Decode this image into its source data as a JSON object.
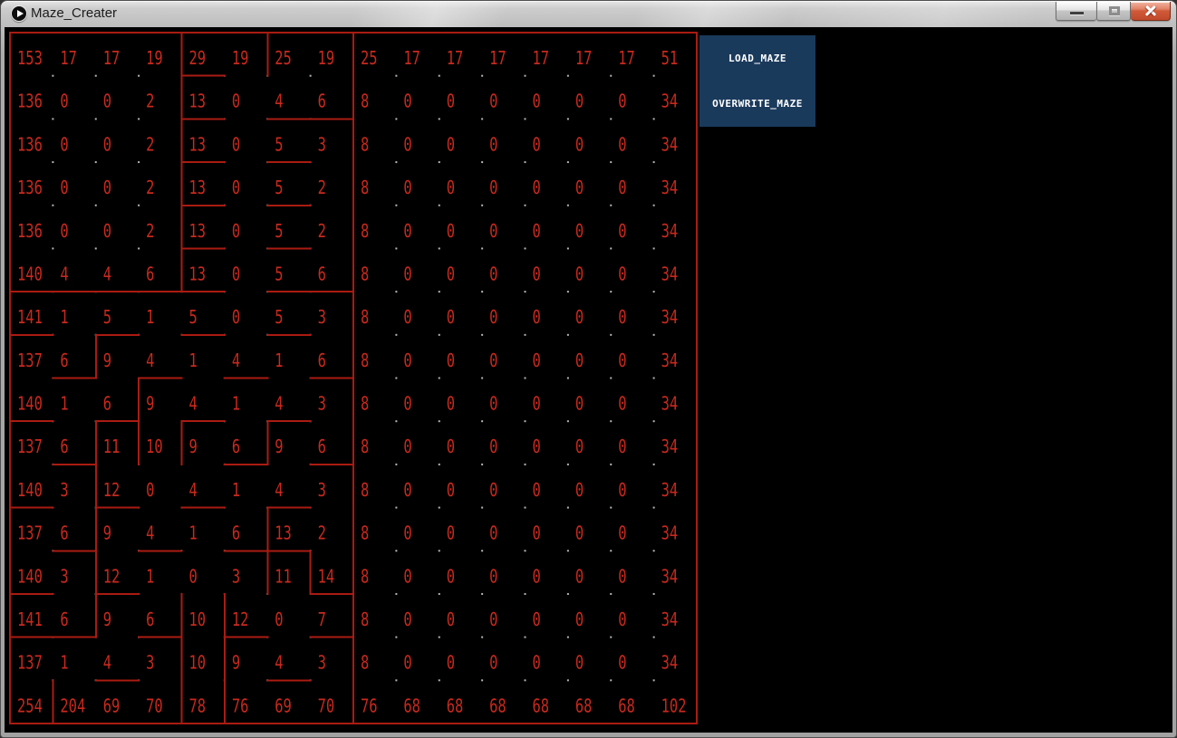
{
  "window": {
    "title": "Maze_Creater",
    "icon": "play-circle-icon",
    "controls": [
      {
        "name": "minimize",
        "icon": "minimize-icon"
      },
      {
        "name": "maximize",
        "icon": "maximize-icon"
      },
      {
        "name": "close",
        "icon": "close-icon"
      }
    ]
  },
  "buttons": [
    {
      "label": "LOAD_MAZE"
    },
    {
      "label": "OVERWRITE_MAZE"
    }
  ],
  "maze": {
    "rows": 16,
    "cols": 16,
    "grid": [
      [
        153,
        17,
        17,
        19,
        29,
        19,
        25,
        19,
        25,
        17,
        17,
        17,
        17,
        17,
        17,
        51
      ],
      [
        136,
        0,
        0,
        2,
        13,
        0,
        4,
        6,
        8,
        0,
        0,
        0,
        0,
        0,
        0,
        34
      ],
      [
        136,
        0,
        0,
        2,
        13,
        0,
        5,
        3,
        8,
        0,
        0,
        0,
        0,
        0,
        0,
        34
      ],
      [
        136,
        0,
        0,
        2,
        13,
        0,
        5,
        2,
        8,
        0,
        0,
        0,
        0,
        0,
        0,
        34
      ],
      [
        136,
        0,
        0,
        2,
        13,
        0,
        5,
        2,
        8,
        0,
        0,
        0,
        0,
        0,
        0,
        34
      ],
      [
        140,
        4,
        4,
        6,
        13,
        0,
        5,
        6,
        8,
        0,
        0,
        0,
        0,
        0,
        0,
        34
      ],
      [
        141,
        1,
        5,
        1,
        5,
        0,
        5,
        3,
        8,
        0,
        0,
        0,
        0,
        0,
        0,
        34
      ],
      [
        137,
        6,
        9,
        4,
        1,
        4,
        1,
        6,
        8,
        0,
        0,
        0,
        0,
        0,
        0,
        34
      ],
      [
        140,
        1,
        6,
        9,
        4,
        1,
        4,
        3,
        8,
        0,
        0,
        0,
        0,
        0,
        0,
        34
      ],
      [
        137,
        6,
        11,
        10,
        9,
        6,
        9,
        6,
        8,
        0,
        0,
        0,
        0,
        0,
        0,
        34
      ],
      [
        140,
        3,
        12,
        0,
        4,
        1,
        4,
        3,
        8,
        0,
        0,
        0,
        0,
        0,
        0,
        34
      ],
      [
        137,
        6,
        9,
        4,
        1,
        6,
        13,
        2,
        8,
        0,
        0,
        0,
        0,
        0,
        0,
        34
      ],
      [
        140,
        3,
        12,
        1,
        0,
        3,
        11,
        14,
        8,
        0,
        0,
        0,
        0,
        0,
        0,
        34
      ],
      [
        141,
        6,
        9,
        6,
        10,
        12,
        0,
        7,
        8,
        0,
        0,
        0,
        0,
        0,
        0,
        34
      ],
      [
        137,
        1,
        4,
        3,
        10,
        9,
        4,
        3,
        8,
        0,
        0,
        0,
        0,
        0,
        0,
        34
      ],
      [
        254,
        204,
        69,
        70,
        78,
        76,
        69,
        70,
        76,
        68,
        68,
        68,
        68,
        68,
        68,
        102
      ]
    ]
  },
  "colors": {
    "background": "#000000",
    "wall": "#aa1b12",
    "cell_text": "#c8291e",
    "post": "#b5b5b5",
    "panel": "#1a3a5c",
    "panel_text": "#ffffff"
  }
}
